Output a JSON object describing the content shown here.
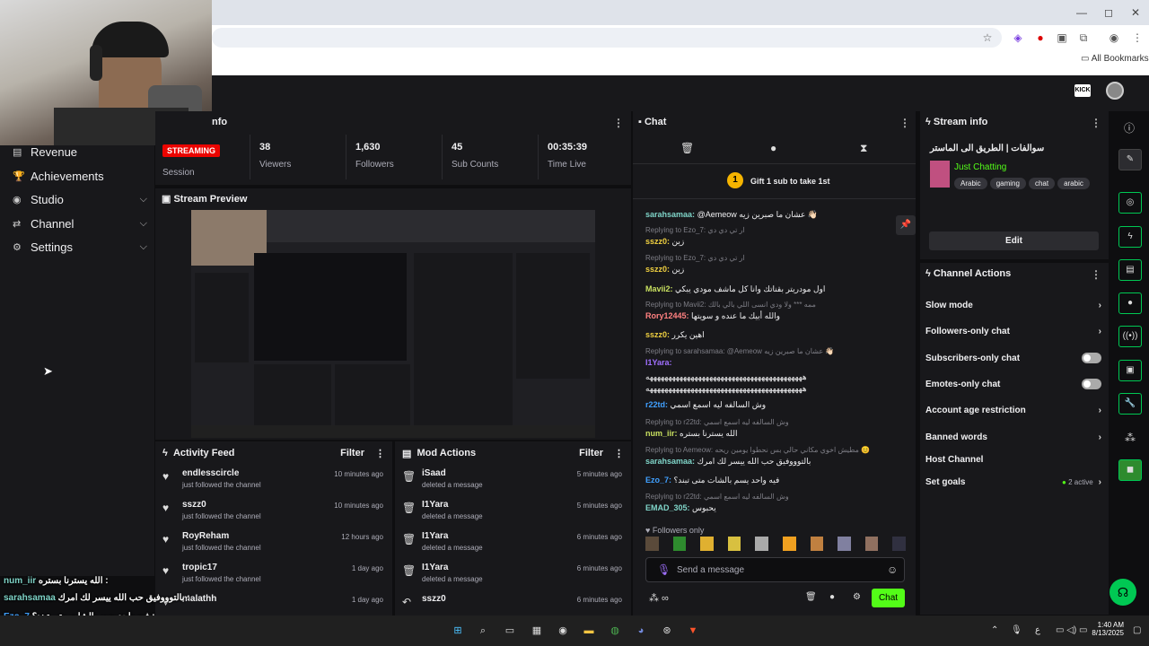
{
  "browser": {
    "bookmarks_label": "All Bookmarks",
    "win_controls": [
      "—",
      "◻",
      "✕"
    ]
  },
  "sidebar": {
    "items": [
      {
        "label": "Revenue",
        "chev": ""
      },
      {
        "label": "Achievements",
        "chev": ""
      },
      {
        "label": "Studio",
        "chev": "⌄"
      },
      {
        "label": "Channel",
        "chev": "⌄"
      },
      {
        "label": "Settings",
        "chev": "⌄"
      }
    ]
  },
  "session_panel": {
    "title_partial": "nfo",
    "badge": "STREAMING",
    "session_label": "Session",
    "stats": [
      {
        "value": "38",
        "label": "Viewers"
      },
      {
        "value": "1,630",
        "label": "Followers"
      },
      {
        "value": "45",
        "label": "Sub Counts"
      },
      {
        "value": "00:35:39",
        "label": "Time Live"
      }
    ]
  },
  "preview": {
    "title": "Stream Preview"
  },
  "activity_feed": {
    "title": "Activity Feed",
    "filter": "Filter",
    "rows": [
      {
        "name": "endlesscircle",
        "sub": "just followed the channel",
        "time": "10 minutes ago"
      },
      {
        "name": "sszz0",
        "sub": "just followed the channel",
        "time": "10 minutes ago"
      },
      {
        "name": "RoyReham",
        "sub": "just followed the channel",
        "time": "12 hours ago"
      },
      {
        "name": "tropic17",
        "sub": "just followed the channel",
        "time": "1 day ago"
      },
      {
        "name": "malathh",
        "sub": "",
        "time": "1 day ago"
      }
    ]
  },
  "mod_actions": {
    "title": "Mod Actions",
    "filter": "Filter",
    "rows": [
      {
        "name": "iSaad",
        "sub": "deleted a message",
        "time": "5 minutes ago"
      },
      {
        "name": "I1Yara",
        "sub": "deleted a message",
        "time": "5 minutes ago"
      },
      {
        "name": "I1Yara",
        "sub": "deleted a message",
        "time": "6 minutes ago"
      },
      {
        "name": "I1Yara",
        "sub": "deleted a message",
        "time": "6 minutes ago"
      },
      {
        "name": "sszz0",
        "sub": "",
        "time": "6 minutes ago"
      }
    ]
  },
  "chat": {
    "title": "Chat",
    "gift_text": "Gift 1 sub to take 1st",
    "followers_only": "Followers only",
    "placeholder": "Send a message",
    "send_button": "Chat",
    "messages": [
      {
        "type": "msg",
        "user": "sarahsamaa:",
        "color": "#7fd4c8",
        "text": "@Aemeow عشان ما صبرين زيه 👋🏻"
      },
      {
        "type": "reply",
        "text": "Replying to Ezo_7: ار تي دي دي"
      },
      {
        "type": "msg",
        "user": "sszz0:",
        "color": "#f0d040",
        "text": "زين"
      },
      {
        "type": "reply",
        "text": "Replying to Ezo_7: ار تي دي دي"
      },
      {
        "type": "msg",
        "user": "sszz0:",
        "color": "#f0d040",
        "text": "زين"
      },
      {
        "type": "msg",
        "user": "Mavii2:",
        "color": "#c8e060",
        "text": "اول مودريتر بقناتك وانا كل ماشف مودي يبكي"
      },
      {
        "type": "reply",
        "text": "Replying to Mavii2: ممه *** ولا ودي انسى اللي بالي بالك"
      },
      {
        "type": "msg",
        "user": "Rory12445:",
        "color": "#ff8080",
        "text": "والله أبيك ما عنده و سويتها"
      },
      {
        "type": "msg",
        "user": "sszz0:",
        "color": "#f0d040",
        "text": "اهين يكرر"
      },
      {
        "type": "reply",
        "text": "Replying to sarahsamaa: @Aemeow عشان ما صبرين زيه 👋🏻"
      },
      {
        "type": "msg",
        "user": "I1Yara:",
        "color": "#a070ff",
        "text": ""
      },
      {
        "type": "msg",
        "user": "",
        "color": "#ffffff",
        "text": "ههههههههههههههههههههههههههههههههههههههههههه"
      },
      {
        "type": "msg",
        "user": "",
        "color": "#ffffff",
        "text": "ههههههههههههههههههههههههههههههههههههههههههه"
      },
      {
        "type": "msg",
        "user": "r22td:",
        "color": "#40a0ff",
        "text": "وش السالفه ليه اسمع اسمي"
      },
      {
        "type": "reply",
        "text": "Replying to r22td: وش السالفه ليه اسمع اسمي"
      },
      {
        "type": "msg",
        "user": "num_iir:",
        "color": "#c8e060",
        "text": "الله يسترنا بستره"
      },
      {
        "type": "reply",
        "text": "Replying to Aemeow: مطيش اخوي مكاني حالي بس نحطوا يومين ريحه 😊"
      },
      {
        "type": "msg",
        "user": "sarahsamaa:",
        "color": "#7fd4c8",
        "text": "بالتوووفيق حب الله ييسر لك امرك"
      },
      {
        "type": "msg",
        "user": "Ezo_7:",
        "color": "#40a0ff",
        "text": "فيه واحد يسم بالشات متى تبند؟"
      },
      {
        "type": "reply",
        "text": "Replying to r22td: وش السالفه ليه اسمع اسمي"
      },
      {
        "type": "msg",
        "user": "EMAD_305:",
        "color": "#7fd4c8",
        "text": "يحبوس"
      }
    ]
  },
  "stream_info": {
    "title": "Stream info",
    "stream_title": "سوالفات | الطريق الى الماستر",
    "category": "Just Chatting",
    "tags": [
      "Arabic",
      "gaming",
      "chat",
      "arabic"
    ],
    "edit": "Edit"
  },
  "channel_actions": {
    "title": "Channel Actions",
    "items": [
      {
        "label": "Slow mode",
        "kind": "chev"
      },
      {
        "label": "Followers-only chat",
        "kind": "chev"
      },
      {
        "label": "Subscribers-only chat",
        "kind": "toggle"
      },
      {
        "label": "Emotes-only chat",
        "kind": "toggle"
      },
      {
        "label": "Account age restriction",
        "kind": "chev"
      },
      {
        "label": "Banned words",
        "kind": "chev"
      },
      {
        "label": "Host Channel",
        "kind": "none"
      },
      {
        "label": "Set goals",
        "kind": "chev"
      }
    ],
    "goals_status": "2 active"
  },
  "overlay_chat": [
    {
      "user": "num_iir",
      "text": "الله يسترنا بستره :"
    },
    {
      "user": "sarahsamaa",
      "text": "بالتوووفيق حب الله ييسر لك امرك :"
    },
    {
      "user": "Ezo_7",
      "text": "فيه واحد يسم بالشات متى تبند؟ :"
    },
    {
      "user": "EMAD_305",
      "text": "يحبوس :"
    }
  ],
  "taskbar": {
    "time": "1:40 AM",
    "date": "8/13/2025",
    "lang": "ع"
  },
  "colors": {
    "accent": "#00c853",
    "streaming": "#eb0400",
    "panel": "#18181b"
  }
}
